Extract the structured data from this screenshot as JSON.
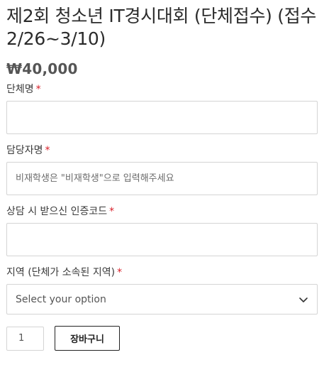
{
  "product": {
    "title": "제2회 청소년 IT경시대회 (단체접수) (접수 2/26~3/10)",
    "price": "₩40,000"
  },
  "form": {
    "required_mark": "*",
    "fields": [
      {
        "label": "단체명",
        "value": "",
        "placeholder": ""
      },
      {
        "label": "담당자명",
        "value": "",
        "placeholder": "비재학생은 \"비재학생\"으로 입력해주세요"
      },
      {
        "label": "상담 시 받으신 인증코드",
        "value": "",
        "placeholder": ""
      }
    ],
    "region": {
      "label": "지역 (단체가 소속된 지역)",
      "selected": "Select your option"
    }
  },
  "cart": {
    "quantity": "1",
    "button_label": "장바구니"
  },
  "colors": {
    "required": "#d81e28",
    "border": "#d4d4d4"
  },
  "icons": {
    "select_arrow": "chevron-down-icon"
  }
}
